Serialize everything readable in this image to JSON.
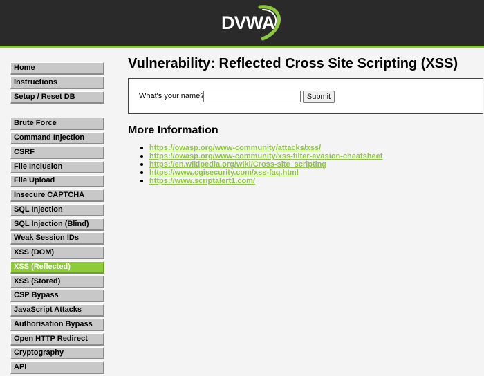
{
  "header": {
    "logo_text": "DVWA",
    "colors": {
      "background": "#2a2a2a",
      "accent": "#8dc63f"
    }
  },
  "menu": {
    "groups": [
      [
        "Home",
        "Instructions",
        "Setup / Reset DB"
      ],
      [
        "Brute Force",
        "Command Injection",
        "CSRF",
        "File Inclusion",
        "File Upload",
        "Insecure CAPTCHA",
        "SQL Injection",
        "SQL Injection (Blind)",
        "Weak Session IDs",
        "XSS (DOM)",
        "XSS (Reflected)",
        "XSS (Stored)",
        "CSP Bypass",
        "JavaScript Attacks",
        "Authorisation Bypass",
        "Open HTTP Redirect",
        "Cryptography",
        "API"
      ]
    ],
    "selected": "XSS (Reflected)"
  },
  "main": {
    "title": "Vulnerability: Reflected Cross Site Scripting (XSS)",
    "form": {
      "label": "What's your name?",
      "input_value": "",
      "submit_label": "Submit"
    },
    "more_info_title": "More Information",
    "links": [
      "https://owasp.org/www-community/attacks/xss/",
      "https://owasp.org/www-community/xss-filter-evasion-cheatsheet",
      "https://en.wikipedia.org/wiki/Cross-site_scripting",
      "https://www.cgisecurity.com/xss-faq.html",
      "https://www.scriptalert1.com/"
    ]
  }
}
